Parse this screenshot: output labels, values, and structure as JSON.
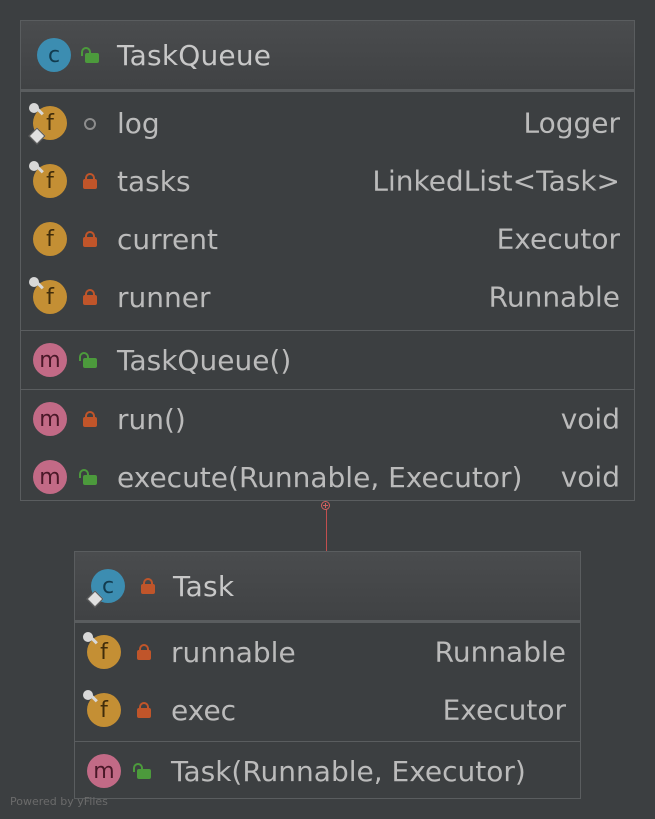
{
  "classes": [
    {
      "name": "TaskQueue",
      "kind": "class",
      "visibility": "public",
      "sections": [
        {
          "kind": "fields",
          "rows": [
            {
              "name": "log",
              "type": "Logger",
              "visibility": "package",
              "final": true,
              "static": true
            },
            {
              "name": "tasks",
              "type": "LinkedList<Task>",
              "visibility": "private",
              "final": true,
              "static": false
            },
            {
              "name": "current",
              "type": "Executor",
              "visibility": "private",
              "final": false,
              "static": false
            },
            {
              "name": "runner",
              "type": "Runnable",
              "visibility": "private",
              "final": true,
              "static": false
            }
          ]
        },
        {
          "kind": "constructors",
          "rows": [
            {
              "name": "TaskQueue()",
              "type": "",
              "visibility": "public"
            }
          ]
        },
        {
          "kind": "methods",
          "rows": [
            {
              "name": "run()",
              "type": "void",
              "visibility": "private"
            },
            {
              "name": "execute(Runnable, Executor)",
              "type": "void",
              "visibility": "public"
            }
          ]
        }
      ]
    },
    {
      "name": "Task",
      "kind": "class",
      "visibility": "private",
      "static": true,
      "sections": [
        {
          "kind": "fields",
          "rows": [
            {
              "name": "runnable",
              "type": "Runnable",
              "visibility": "private",
              "final": true,
              "static": false
            },
            {
              "name": "exec",
              "type": "Executor",
              "visibility": "private",
              "final": true,
              "static": false
            }
          ]
        },
        {
          "kind": "constructors",
          "rows": [
            {
              "name": "Task(Runnable, Executor)",
              "type": "",
              "visibility": "public"
            }
          ]
        }
      ]
    }
  ],
  "relationship": {
    "from": "Task",
    "to": "TaskQueue",
    "kind": "inner-class",
    "color": "#c24f4f"
  },
  "footer": "Powered by yFiles",
  "colors": {
    "background": "#3c3f41",
    "border": "#5a5d5f",
    "text": "#bbbbbb",
    "class_badge": "#3c8db1",
    "field_badge": "#c48f34",
    "method_badge": "#c26a86",
    "private": "#c0552a",
    "public": "#4c9a3c"
  }
}
